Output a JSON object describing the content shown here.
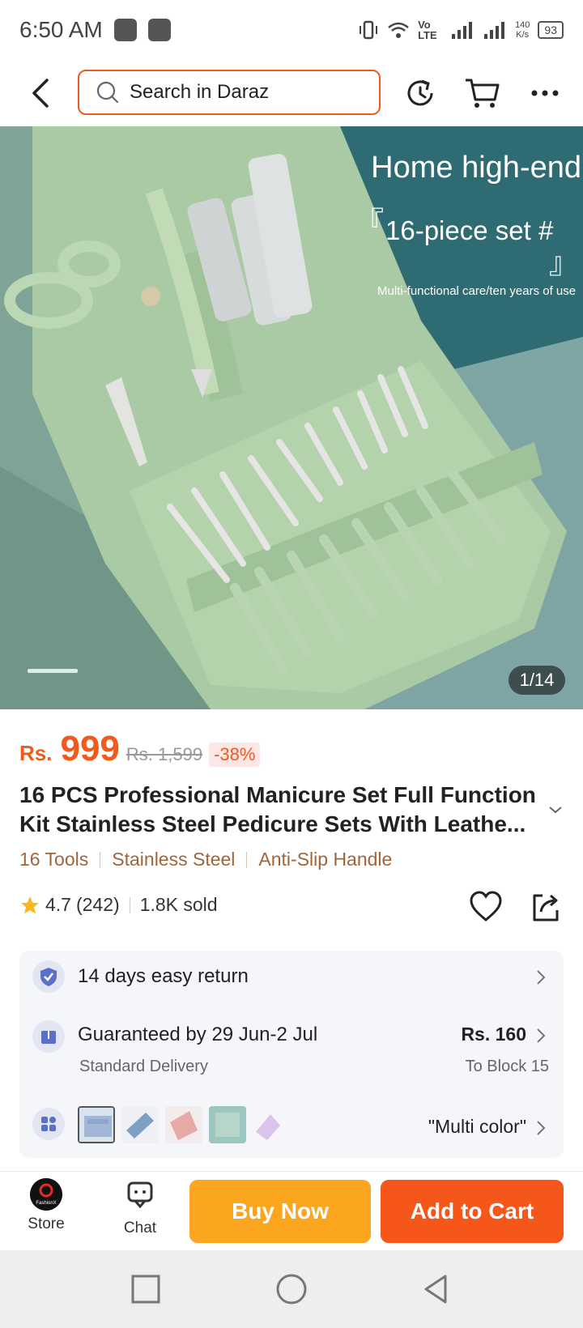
{
  "status_bar": {
    "time": "6:50 AM",
    "network": "Vo LTE",
    "speed_value": "140",
    "speed_unit": "K/s",
    "battery": "93"
  },
  "top_nav": {
    "search_placeholder": "Search in Daraz"
  },
  "gallery": {
    "overlay_title": "Home high-end",
    "overlay_subtitle": "16-piece set #",
    "overlay_note": "Multi-functional care/ten years of use",
    "counter": "1/14"
  },
  "product": {
    "currency": "Rs.",
    "price": "999",
    "original_price": "Rs. 1,599",
    "discount": "-38%",
    "title": "16 PCS Professional Manicure Set Full Function Kit Stainless Steel Pedicure Sets With Leathe...",
    "attributes": [
      "16 Tools",
      "Stainless Steel",
      "Anti-Slip Handle"
    ],
    "rating": "4.7",
    "reviews": "(242)",
    "sold": "1.8K sold"
  },
  "services": {
    "return_text": "14 days easy return",
    "delivery_text": "Guaranteed by 29 Jun-2 Jul",
    "delivery_type": "Standard Delivery",
    "delivery_price": "Rs. 160",
    "delivery_destination": "To Block 15",
    "variant": "\"Multi color\""
  },
  "bottom_bar": {
    "store_label": "Store",
    "chat_label": "Chat",
    "buy_now": "Buy Now",
    "add_to_cart": "Add to Cart",
    "store_logo_text": "FashionX"
  },
  "colors": {
    "accent": "#f05a1a",
    "buy_now": "#fca51f",
    "add_to_cart": "#f5561a",
    "attribute_text": "#a0653a"
  },
  "icons": {
    "back": "back-arrow-icon",
    "search": "search-icon",
    "history": "history-icon",
    "cart": "cart-icon",
    "more": "more-icon"
  }
}
